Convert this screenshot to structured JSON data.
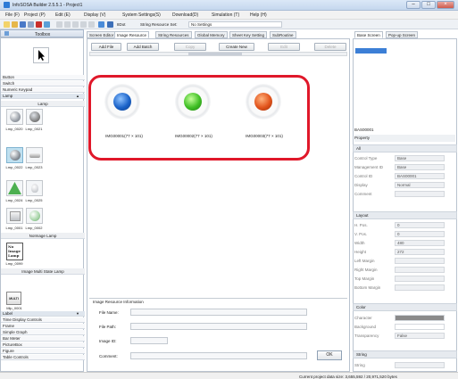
{
  "window": {
    "title": "InfoSOSA Builder 2.5.5.1 - Project1"
  },
  "menu": [
    "File (F)",
    "Project (P)",
    "Edit (E)",
    "Display (V)",
    "System Settings(S)",
    "Download(D)",
    "Simulation (T)",
    "Help (H)"
  ],
  "toolbar": {
    "bit_label": "8Dot",
    "string_resource_label": "String Resource Set:",
    "string_resource_value": "No Settings"
  },
  "toolbox": {
    "title": "Toolbox",
    "categories_top": [
      "Button",
      "Switch",
      "Numeric Keypad",
      "Lamp"
    ],
    "lamp_group_title": "Lamp",
    "lamps": [
      "Lmp_0020",
      "Lmp_0021",
      "Lmp_0022",
      "Lmp_0023",
      "Lmp_0024",
      "Lmp_0025",
      "Lmp_0001",
      "Lmp_0002"
    ],
    "noimage_title": "NoImage Lamp",
    "noimage_text": "No Image Lamp",
    "noimage_item": "Lmp_0099",
    "multi_title": "Image Multi State Lamp",
    "multi_text": "MULTI",
    "multi_item": "Mlp_0001",
    "categories_bottom": [
      "Label",
      "Time Display Controls",
      "Frame",
      "Simple Graph",
      "Bar Meter",
      "PictureBox",
      "Figure",
      "Table Controls"
    ]
  },
  "tabs": [
    "Screen Editor",
    "Image Resource",
    "String Resources",
    "Global Memory",
    "Sheet Key Setting",
    "SubRoutine"
  ],
  "active_tab": "Image Resource",
  "actions": [
    "Add File",
    "Add Batch",
    "Copy",
    "Create New",
    "Edit",
    "Delete"
  ],
  "images": [
    {
      "label": "IMG00001(77 × 101)",
      "color": "#1b63c9"
    },
    {
      "label": "IMG00002(77 × 101)",
      "color": "#3fbf24"
    },
    {
      "label": "IMG00003(77 × 101)",
      "color": "#e2541c"
    }
  ],
  "highlight_color": "#e0182a",
  "info": {
    "title": "Image Resource Information",
    "file_name_label": "File Name:",
    "file_path_label": "File Path:",
    "image_id_label": "Image ID:",
    "comment_label": "Comment:",
    "ok_label": "OK"
  },
  "right": {
    "tabs": [
      "Base Screen",
      "Pop-up Screen"
    ],
    "selected_object": "BAS00001",
    "property_label": "Property",
    "sections": {
      "all": "All",
      "layout": "Layout",
      "color": "Color",
      "string": "String"
    },
    "all_rows": [
      {
        "label": "Control Type",
        "value": "Base"
      },
      {
        "label": "Management ID",
        "value": "Base"
      },
      {
        "label": "Control ID",
        "value": "BAS00001"
      },
      {
        "label": "Display",
        "value": "Normal"
      },
      {
        "label": "Comment",
        "value": ""
      }
    ],
    "layout_rows": [
      {
        "label": "H. Pos.",
        "value": "0"
      },
      {
        "label": "V. Pos.",
        "value": "0"
      },
      {
        "label": "Width",
        "value": "480"
      },
      {
        "label": "Height",
        "value": "272"
      },
      {
        "label": "Left Margin",
        "value": ""
      },
      {
        "label": "Right Margin",
        "value": ""
      },
      {
        "label": "Top Margin",
        "value": ""
      },
      {
        "label": "Bottom Margin",
        "value": ""
      }
    ],
    "color_rows": [
      {
        "label": "Character",
        "value": ""
      },
      {
        "label": "Background",
        "value": ""
      },
      {
        "label": "Transparency",
        "value": "False"
      }
    ],
    "string_rows": [
      {
        "label": "String",
        "value": ""
      }
    ]
  },
  "status": {
    "text": "Current project data size: 3,655,592 / 20,971,520 bytes"
  }
}
